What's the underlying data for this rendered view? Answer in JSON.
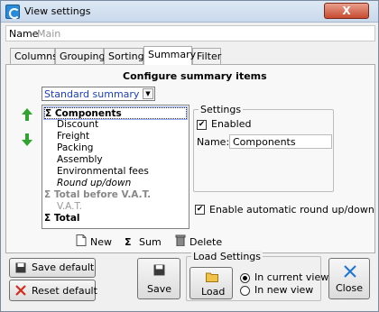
{
  "window": {
    "title": "View settings",
    "close_glyph": "X"
  },
  "name_row": {
    "label": "Name",
    "value": "Main"
  },
  "tabs": [
    "Columns",
    "Grouping",
    "Sorting",
    "Summary",
    "Filter"
  ],
  "summary": {
    "heading": "Configure summary items",
    "mode_select": "Standard summary",
    "items": [
      {
        "label": "Σ Components"
      },
      {
        "label": "Discount"
      },
      {
        "label": "Freight"
      },
      {
        "label": "Packing"
      },
      {
        "label": "Assembly"
      },
      {
        "label": "Environmental fees"
      },
      {
        "label": "Round up/down"
      },
      {
        "label": "Σ Total before V.A.T."
      },
      {
        "label": "V.A.T."
      },
      {
        "label": "Σ Total"
      }
    ],
    "settings_legend": "Settings",
    "enabled_label": "Enabled",
    "enabled_checked": true,
    "name_label": "Name:",
    "name_value": "Components",
    "auto_round_label": "Enable automatic round up/down",
    "auto_round_checked": true,
    "actions": {
      "new": "New",
      "sum": "Sum",
      "delete": "Delete",
      "sum_glyph": "Σ"
    }
  },
  "footer": {
    "save_default": "Save default",
    "reset_default": "Reset default",
    "save": "Save",
    "load_settings_legend": "Load Settings",
    "load": "Load",
    "in_current_view": "In current view",
    "in_new_view": "In new view",
    "in_current_view_selected": true,
    "close": "Close"
  },
  "icons": [
    "app-icon",
    "arrow-up-icon",
    "arrow-down-icon",
    "new-document-icon",
    "sigma-icon",
    "trash-icon",
    "floppy-disk-icon",
    "red-x-icon",
    "folder-icon",
    "blue-x-icon"
  ],
  "colors": {
    "accent_blue": "#1b3fbf",
    "close_red": "#c64a30",
    "arrow_green": "#2fa52f"
  }
}
